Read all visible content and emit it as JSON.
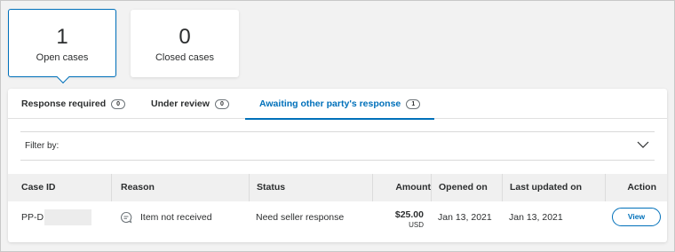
{
  "summary": {
    "open": {
      "count": "1",
      "label": "Open cases"
    },
    "closed": {
      "count": "0",
      "label": "Closed cases"
    }
  },
  "tabs": [
    {
      "label": "Response required",
      "count": "0",
      "active": false
    },
    {
      "label": "Under review",
      "count": "0",
      "active": false
    },
    {
      "label": "Awaiting other party's response",
      "count": "1",
      "active": true
    }
  ],
  "filter": {
    "label": "Filter by:"
  },
  "table": {
    "headers": {
      "case_id": "Case ID",
      "reason": "Reason",
      "status": "Status",
      "amount": "Amount",
      "opened_on": "Opened on",
      "last_updated": "Last updated on",
      "action": "Action"
    },
    "rows": [
      {
        "case_id": "PP-D",
        "reason": "Item not received",
        "status": "Need seller response",
        "amount": "$25.00",
        "currency": "USD",
        "opened_on": "Jan 13, 2021",
        "last_updated": "Jan 13, 2021",
        "action": "View"
      }
    ]
  },
  "colors": {
    "accent": "#0070ba",
    "text": "#2c2e2f",
    "header_bg": "#f0f0f0"
  }
}
